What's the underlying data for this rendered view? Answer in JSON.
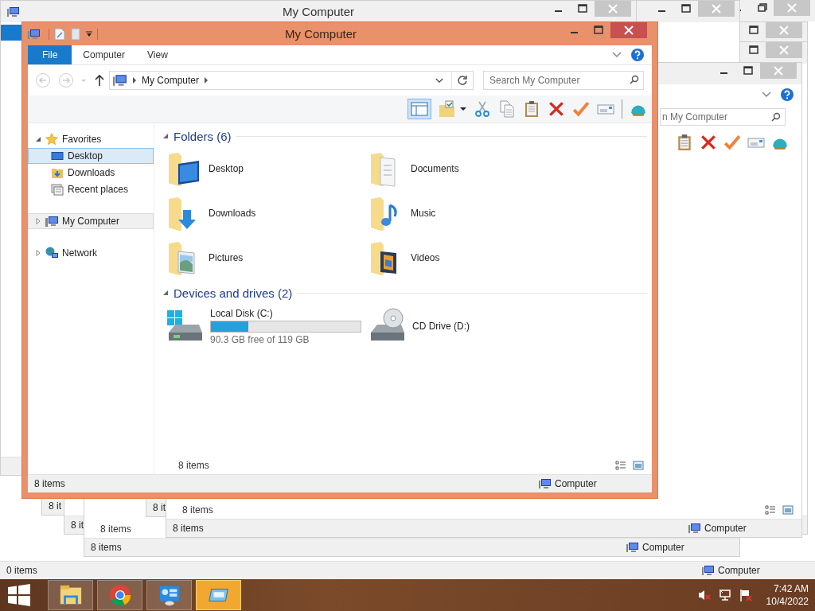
{
  "desktop_windows": [
    {
      "kind": "maximized",
      "status_left": "0 items",
      "status_right": "Computer"
    },
    {
      "kind": "window",
      "status_left": "8 it"
    },
    {
      "kind": "window",
      "status_left": "8 it"
    },
    {
      "kind": "window",
      "content_count": "8 items",
      "status_left": "8 items",
      "status_right": "Computer"
    },
    {
      "kind": "window",
      "status_left": "8 it"
    },
    {
      "kind": "window",
      "content_count": "8 items",
      "status_left": "8 items",
      "status_right": "Computer",
      "search_placeholder": "n My Computer",
      "ribbon": true
    },
    {
      "kind": "window",
      "title": "My Computer",
      "ribbon": true
    }
  ],
  "window": {
    "title": "My Computer"
  },
  "ribbon": {
    "tabs": [
      {
        "label": "File",
        "kind": "file"
      },
      {
        "label": "Computer",
        "kind": "tab"
      },
      {
        "label": "View",
        "kind": "tab"
      }
    ]
  },
  "address": {
    "path": "My Computer",
    "search_placeholder": "Search My Computer"
  },
  "navigation": [
    {
      "label": "Favorites",
      "kind": "favorites",
      "expanded": true,
      "selected": false,
      "children": [
        {
          "label": "Desktop",
          "kind": "desktop",
          "selected": true
        },
        {
          "label": "Downloads",
          "kind": "downloads",
          "selected": false
        },
        {
          "label": "Recent places",
          "kind": "recent",
          "selected": false
        }
      ]
    },
    {
      "label": "My Computer",
      "kind": "computer",
      "expanded": false,
      "selected": false,
      "hovered": true
    },
    {
      "label": "Network",
      "kind": "network",
      "expanded": false,
      "selected": false
    }
  ],
  "folders": {
    "heading": "Folders (6)",
    "expanded": true,
    "items": [
      {
        "name": "Desktop",
        "kind": "desktop"
      },
      {
        "name": "Documents",
        "kind": "documents"
      },
      {
        "name": "Downloads",
        "kind": "downloads"
      },
      {
        "name": "Music",
        "kind": "music"
      },
      {
        "name": "Pictures",
        "kind": "pictures"
      },
      {
        "name": "Videos",
        "kind": "videos"
      }
    ]
  },
  "drives": {
    "heading": "Devices and drives (2)",
    "expanded": true,
    "items": [
      {
        "name": "Local Disk (C:)",
        "kind": "hdd",
        "level": 0.25,
        "free": "90.3 GB free of 119 GB"
      },
      {
        "name": "CD Drive (D:)",
        "kind": "cd"
      }
    ]
  },
  "content_count": "8 items",
  "status_bar": {
    "left": "8 items",
    "right": "Computer"
  },
  "taskbar": {
    "apps": [
      {
        "kind": "explorer",
        "active": false
      },
      {
        "kind": "chrome",
        "active": false
      },
      {
        "kind": "control",
        "active": false
      },
      {
        "kind": "window",
        "active": true
      }
    ],
    "clock": {
      "time": "7:42 AM",
      "date": "10/4/2022"
    }
  }
}
